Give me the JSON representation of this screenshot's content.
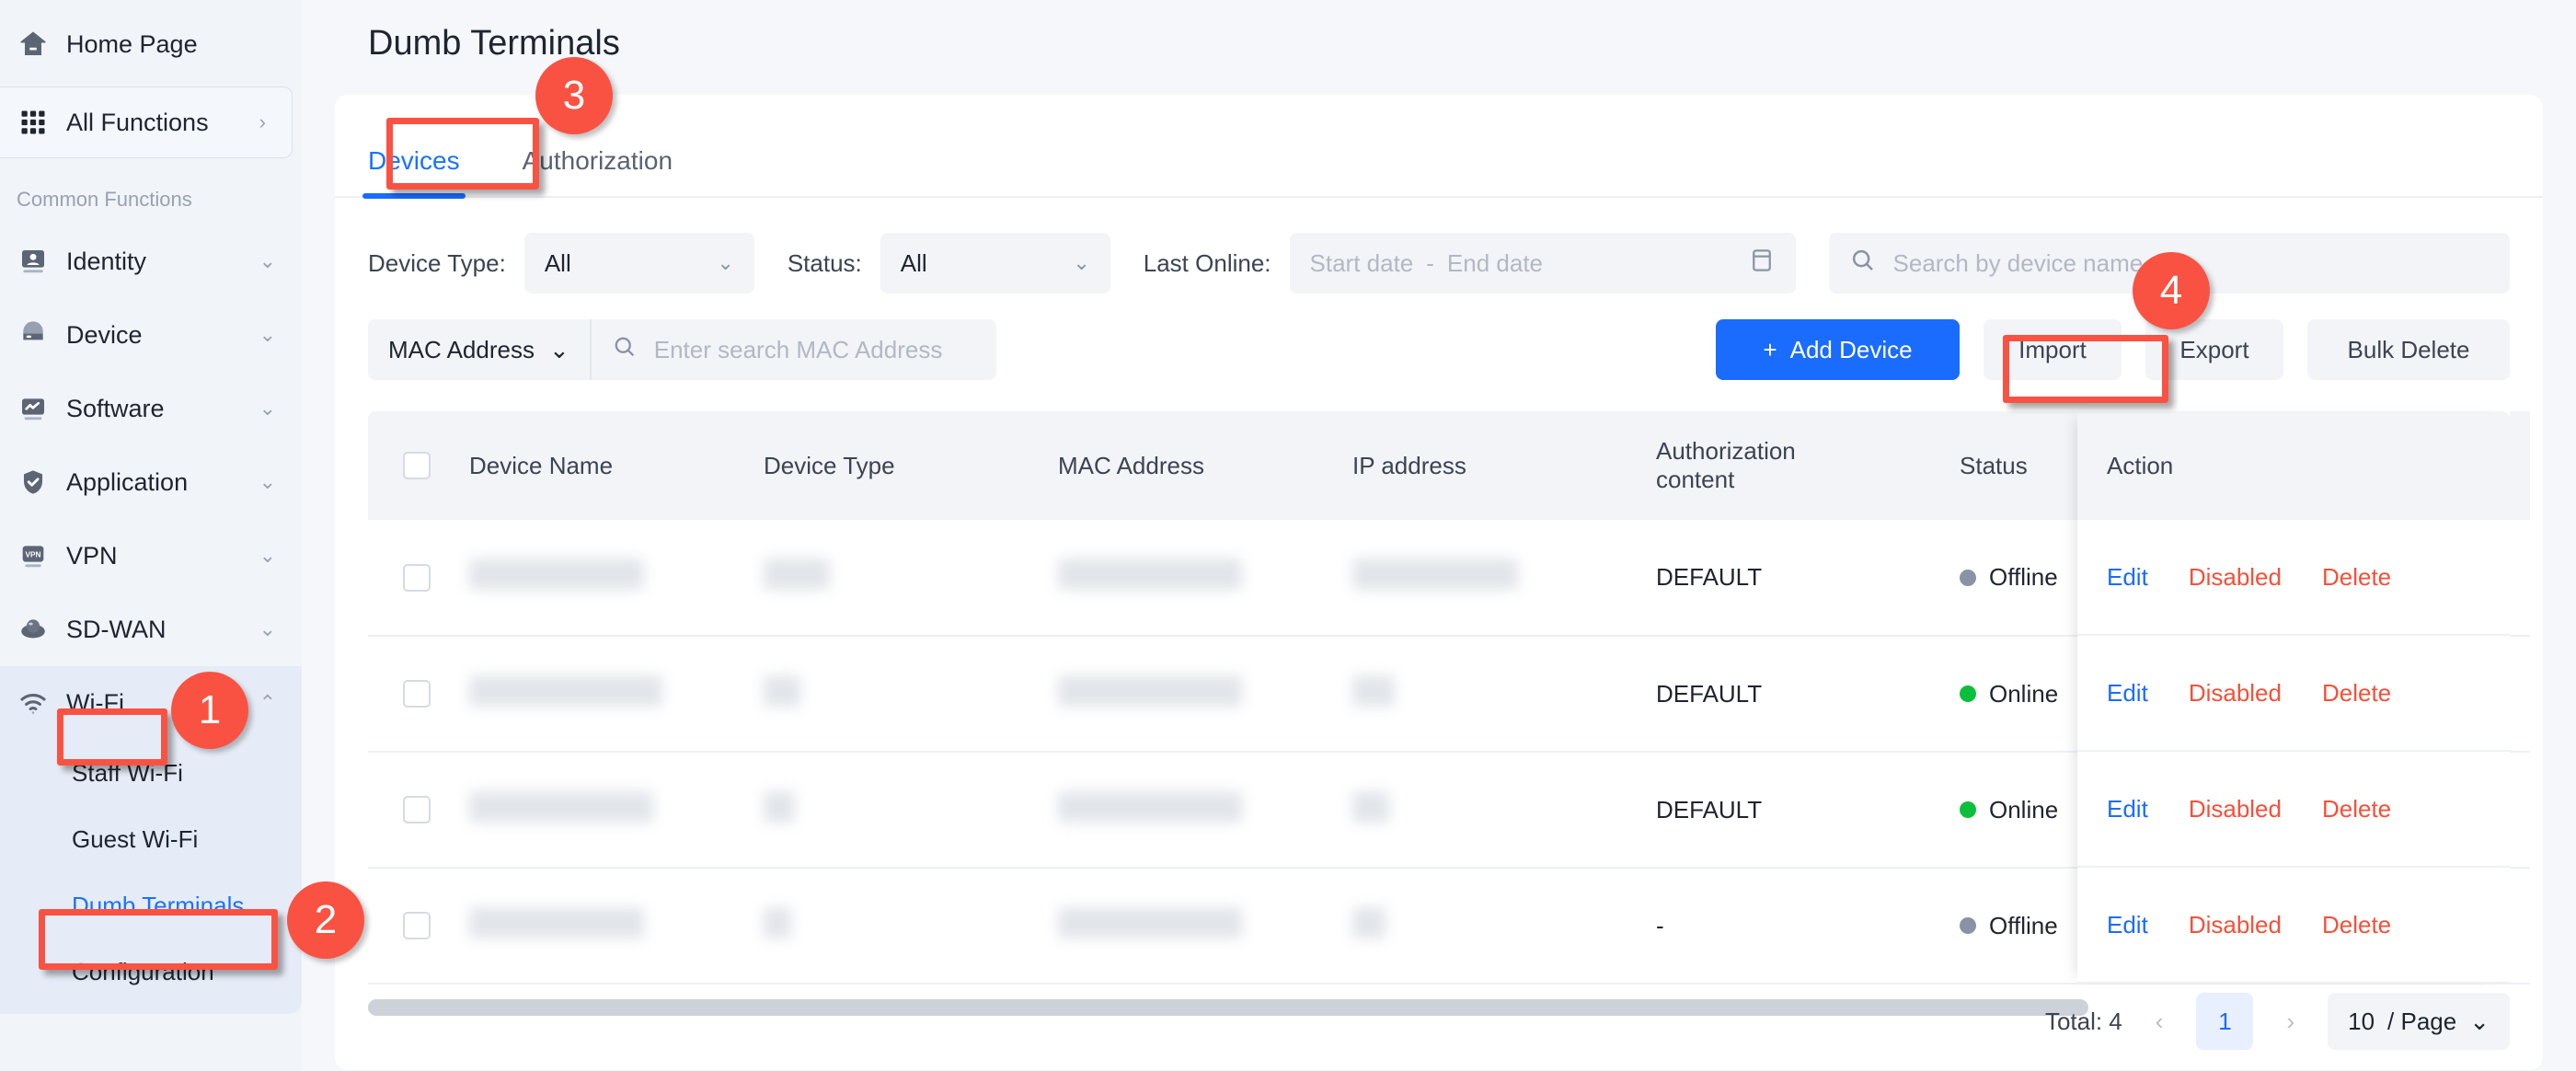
{
  "sidebar": {
    "home": {
      "label": "Home Page",
      "icon": "home-icon"
    },
    "all_functions": {
      "label": "All Functions",
      "icon": "grid-icon",
      "chevron": "›"
    },
    "section_title": "Common Functions",
    "items": [
      {
        "label": "Identity",
        "icon": "identity-icon",
        "chevron": "⌄"
      },
      {
        "label": "Device",
        "icon": "device-icon",
        "chevron": "⌄"
      },
      {
        "label": "Software",
        "icon": "software-icon",
        "chevron": "⌄"
      },
      {
        "label": "Application",
        "icon": "application-shield-icon",
        "chevron": "⌄"
      },
      {
        "label": "VPN",
        "icon": "vpn-icon",
        "chevron": "⌄"
      },
      {
        "label": "SD-WAN",
        "icon": "sdwan-icon",
        "chevron": "⌄"
      },
      {
        "label": "Wi-Fi",
        "icon": "wifi-icon",
        "chevron": "⌃"
      }
    ],
    "wifi_submenu": [
      {
        "label": "Staff Wi-Fi",
        "active": false
      },
      {
        "label": "Guest Wi-Fi",
        "active": false
      },
      {
        "label": "Dumb Terminals",
        "active": true
      },
      {
        "label": "Configuration",
        "active": false
      }
    ]
  },
  "page": {
    "title": "Dumb Terminals",
    "tabs": [
      {
        "label": "Devices",
        "active": true
      },
      {
        "label": "Authorization",
        "active": false
      }
    ]
  },
  "filters": {
    "device_type_label": "Device Type:",
    "device_type_value": "All",
    "status_label": "Status:",
    "status_value": "All",
    "last_online_label": "Last Online:",
    "start_date_placeholder": "Start date",
    "date_dash": "-",
    "end_date_placeholder": "End date",
    "calendar_icon": "calendar-icon",
    "search_placeholder": "Search by device name",
    "search_icon": "search-icon",
    "chevron": "⌄"
  },
  "toolbar": {
    "mac_field_label": "MAC Address",
    "mac_search_placeholder": "Enter search MAC Address",
    "add_device_label": "Add Device",
    "add_device_plus": "+",
    "import_label": "Import",
    "export_label": "Export",
    "bulk_delete_label": "Bulk Delete"
  },
  "table": {
    "columns": [
      "Device Name",
      "Device Type",
      "MAC Address",
      "IP address",
      "Authorization content",
      "Status",
      "Action"
    ],
    "auth_header_line1": "Authorization",
    "auth_header_line2": "content",
    "rows": [
      {
        "device_name": "",
        "device_type": "",
        "mac": "",
        "ip": "",
        "auth": "DEFAULT",
        "status": "Offline",
        "status_kind": "offline"
      },
      {
        "device_name": "",
        "device_type": "",
        "mac": "",
        "ip": "",
        "auth": "DEFAULT",
        "status": "Online",
        "status_kind": "online"
      },
      {
        "device_name": "",
        "device_type": "",
        "mac": "",
        "ip": "",
        "auth": "DEFAULT",
        "status": "Online",
        "status_kind": "online"
      },
      {
        "device_name": "",
        "device_type": "",
        "mac": "",
        "ip": "",
        "auth": "-",
        "status": "Offline",
        "status_kind": "offline"
      }
    ],
    "actions": {
      "edit": "Edit",
      "disabled": "Disabled",
      "delete": "Delete"
    }
  },
  "pagination": {
    "total": "Total: 4",
    "prev": "‹",
    "page": "1",
    "next": "›",
    "page_size": "10",
    "page_size_suffix": "/ Page",
    "chevron": "⌄"
  },
  "annotations": {
    "badges": [
      {
        "n": "1"
      },
      {
        "n": "2"
      },
      {
        "n": "3"
      },
      {
        "n": "4"
      }
    ]
  },
  "colors": {
    "accent": "#1a6cff",
    "danger": "#f5503a",
    "annotation": "#fa5242",
    "online": "#0bbf3c",
    "offline": "#8a93a5"
  }
}
